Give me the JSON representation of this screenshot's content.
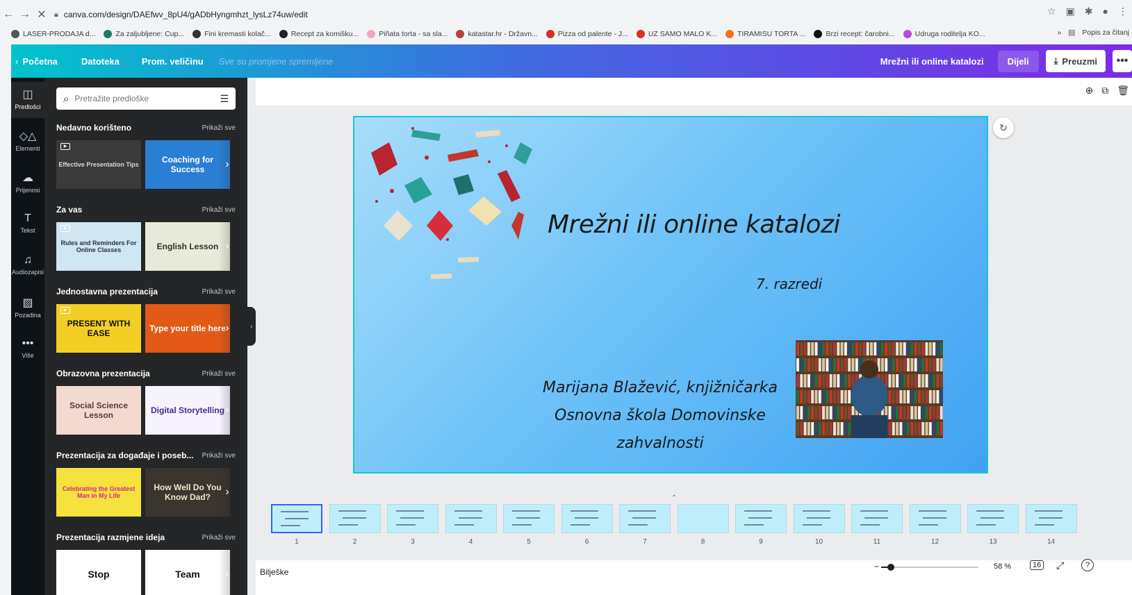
{
  "browser": {
    "url": "canva.com/design/DAEfwv_8pU4/gADbHyngmhzt_lysLz74uw/edit",
    "bookmarks": [
      {
        "label": "LASER-PRODAJA d...",
        "color": "#555555"
      },
      {
        "label": "Za zaljubljene: Cup...",
        "color": "#1e7c6b"
      },
      {
        "label": "Fini kremasti kolač...",
        "color": "#333333"
      },
      {
        "label": "Recept za komišku...",
        "color": "#222222"
      },
      {
        "label": "Piñata torta - sa sla...",
        "color": "#f4a6b8"
      },
      {
        "label": "katastar.hr - Državn...",
        "color": "#b5413c"
      },
      {
        "label": "Pizza od palente - J...",
        "color": "#d93025"
      },
      {
        "label": "UZ SAMO MALO K...",
        "color": "#d93025"
      },
      {
        "label": "TIRAMISU TORTA ...",
        "color": "#f47216"
      },
      {
        "label": "Brzi recept: čarobni...",
        "color": "#111111"
      },
      {
        "label": "Udruga roditelja KO...",
        "color": "#b04fd6"
      }
    ],
    "more_bookmarks": "»",
    "reading_list": "Popis za čitanj"
  },
  "topbar": {
    "home": "Početna",
    "file": "Datoteka",
    "resize": "Prom. veličinu",
    "saved": "Sve su promjene spremljene",
    "design_title": "Mrežni ili online katalozi",
    "share": "Dijeli",
    "download": "Preuzmi",
    "more": "•••"
  },
  "rail": [
    {
      "label": "Predlošci",
      "icon": "templates-icon",
      "glyph": "◫",
      "active": true
    },
    {
      "label": "Elementi",
      "icon": "elements-icon",
      "glyph": "◇△",
      "active": false
    },
    {
      "label": "Prijenosi",
      "icon": "upload-icon",
      "glyph": "☁",
      "active": false
    },
    {
      "label": "Tekst",
      "icon": "text-icon",
      "glyph": "T",
      "active": false
    },
    {
      "label": "Audiozapisi",
      "icon": "music-icon",
      "glyph": "♫",
      "active": false
    },
    {
      "label": "Pozadina",
      "icon": "background-icon",
      "glyph": "▨",
      "active": false
    },
    {
      "label": "Više",
      "icon": "more-icon",
      "glyph": "•••",
      "active": false
    }
  ],
  "search": {
    "placeholder": "Pretražite predloške"
  },
  "sections": [
    {
      "title": "Nedavno korišteno",
      "link": "Prikaži sve",
      "thumbs": [
        {
          "text": "Effective Presentation Tips",
          "bg": "#3a3a3a",
          "fg": "#d9d9d9"
        },
        {
          "text": "Coaching for Success",
          "bg": "#2a7fd4",
          "fg": "#ffffff"
        }
      ]
    },
    {
      "title": "Za vas",
      "link": "Prikaži sve",
      "thumbs": [
        {
          "text": "Rules and Reminders For Online Classes",
          "bg": "#cfe6f3",
          "fg": "#23314a"
        },
        {
          "text": "English Lesson",
          "bg": "#e8ead9",
          "fg": "#2f2f2f"
        }
      ]
    },
    {
      "title": "Jednostavna prezentacija",
      "link": "Prikaži sve",
      "thumbs": [
        {
          "text": "PRESENT WITH EASE",
          "bg": "#f3cf25",
          "fg": "#111111"
        },
        {
          "text": "Type your title here",
          "bg": "#e35a17",
          "fg": "#ffffff"
        }
      ]
    },
    {
      "title": "Obrazovna prezentacija",
      "link": "Prikaži sve",
      "thumbs": [
        {
          "text": "Social Science Lesson",
          "bg": "#f3d9cf",
          "fg": "#5a3a2a"
        },
        {
          "text": "Digital Storytelling",
          "bg": "#f6f3ff",
          "fg": "#4a2a8a"
        }
      ]
    },
    {
      "title": "Prezentacija za događaje i poseb...",
      "link": "Prikaži sve",
      "thumbs": [
        {
          "text": "Celebrating the Greatest Man in My Life",
          "bg": "#f5e23c",
          "fg": "#d8268a"
        },
        {
          "text": "How Well Do You Know Dad?",
          "bg": "#3a352e",
          "fg": "#f0e6d0"
        }
      ]
    },
    {
      "title": "Prezentacija razmjene ideja",
      "link": "Prikaži sve",
      "thumbs": [
        {
          "text": "Stop",
          "bg": "#ffffff",
          "fg": "#111111"
        },
        {
          "text": "Team",
          "bg": "#ffffff",
          "fg": "#111111"
        }
      ]
    }
  ],
  "slide": {
    "title": "Mrežni ili online katalozi",
    "subtitle": "7. razredi",
    "author_line1": "Marijana Blažević, knjižničarka",
    "author_line2": "Osnovna škola Domovinske zahvalnosti"
  },
  "filmstrip": {
    "pages": [
      "1",
      "2",
      "3",
      "4",
      "5",
      "6",
      "7",
      "8",
      "9",
      "10",
      "11",
      "12",
      "13",
      "14"
    ],
    "active_page": "1"
  },
  "bottombar": {
    "notes": "Bilješke",
    "zoom": "58 %",
    "zoom_level": 0.1,
    "pages_count": "16"
  }
}
